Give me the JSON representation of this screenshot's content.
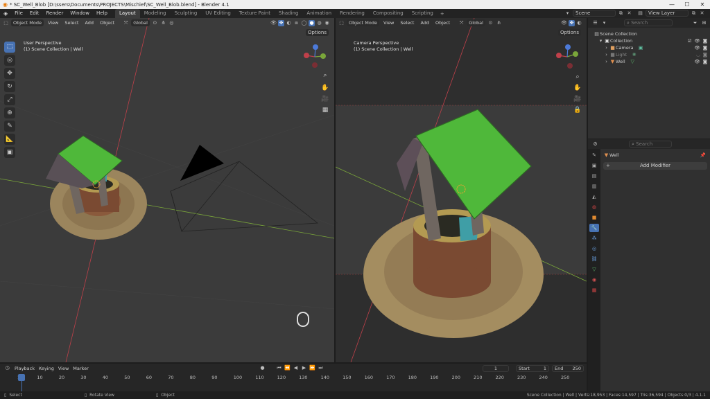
{
  "window": {
    "title": "* SC_Well_Blob [D:\\ssers\\Documents\\PROJECTS\\Mischief\\SC_Well_Blob.blend] - Blender 4.1",
    "controls": [
      "—",
      "☐",
      "✕"
    ]
  },
  "menu": [
    "File",
    "Edit",
    "Render",
    "Window",
    "Help"
  ],
  "workspaces": [
    "Layout",
    "Modeling",
    "Sculpting",
    "UV Editing",
    "Texture Paint",
    "Shading",
    "Animation",
    "Rendering",
    "Compositing",
    "Scripting"
  ],
  "scene_label": "Scene",
  "view_layer_label": "View Layer",
  "viewport_left": {
    "mode": "Object Mode",
    "menus": [
      "View",
      "Select",
      "Add",
      "Object"
    ],
    "orientation": "Global",
    "options": "Options",
    "overlay_title": "User Perspective",
    "overlay_collection": "(1) Scene Collection | Well"
  },
  "viewport_right": {
    "mode": "Object Mode",
    "menus": [
      "View",
      "Select",
      "Add",
      "Object"
    ],
    "orientation": "Global",
    "options": "Options",
    "overlay_title": "Camera Perspective",
    "overlay_collection": "(1) Scene Collection | Well"
  },
  "outliner": {
    "search_placeholder": "Search",
    "root": "Scene Collection",
    "collection": "Collection",
    "items": [
      {
        "name": "Camera",
        "color": "#e0a060"
      },
      {
        "name": "Light",
        "color": "#777777"
      },
      {
        "name": "Well",
        "color": "#e09050"
      }
    ]
  },
  "properties": {
    "search_placeholder": "Search",
    "object_name": "Well",
    "add_modifier": "Add Modifier"
  },
  "timeline": {
    "menus": [
      "Playback",
      "Keying",
      "View",
      "Marker"
    ],
    "current_frame": "1",
    "start_label": "Start",
    "start": "1",
    "end_label": "End",
    "end": "250",
    "ruler": [
      "1",
      "10",
      "20",
      "30",
      "40",
      "50",
      "60",
      "70",
      "80",
      "90",
      "100",
      "110",
      "120",
      "130",
      "140",
      "150",
      "160",
      "170",
      "180",
      "190",
      "200",
      "210",
      "220",
      "230",
      "240",
      "250"
    ]
  },
  "status": {
    "select": "Select",
    "rotate": "Rotate View",
    "object": "Object",
    "stats": "Scene Collection | Well | Verts:18,953 | Faces:14,597 | Tris:36,594 | Objects:0/3 | 4.1.1"
  },
  "colors": {
    "accent": "#4772b3",
    "viewport_bg": "#3b3b3b",
    "roof_green": "#4fb83a",
    "x_axis": "#c0404a",
    "y_axis": "#7aa63a"
  }
}
